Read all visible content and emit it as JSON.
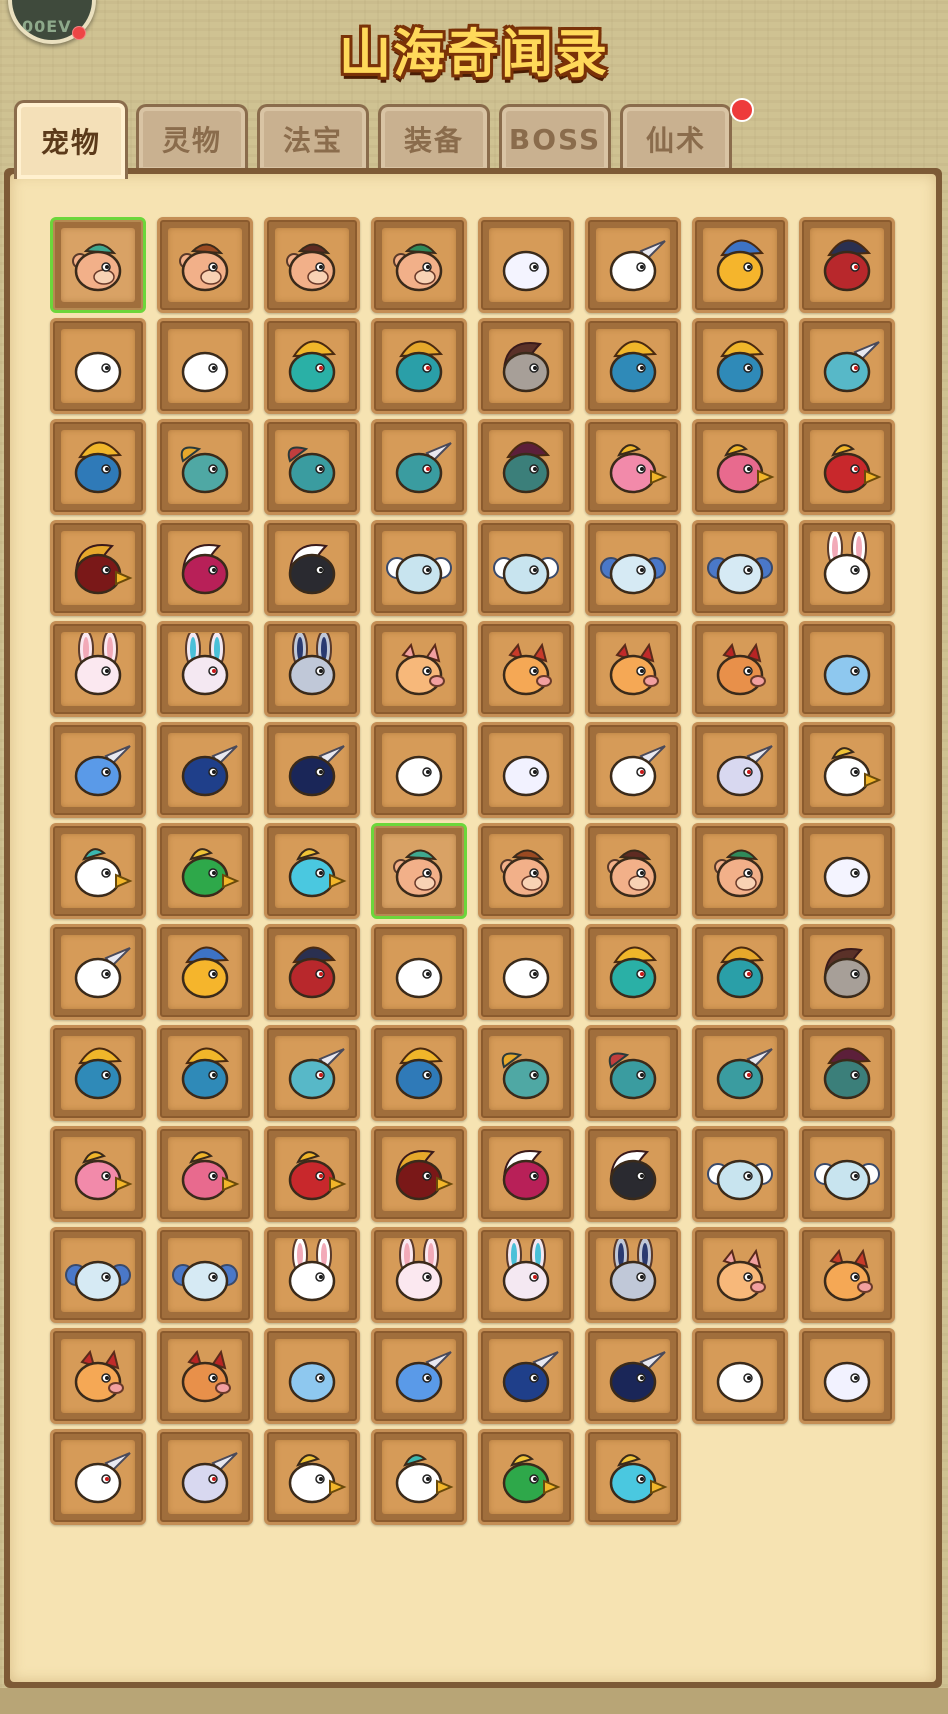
{
  "header": {
    "title": "山海奇闻录",
    "avatar_text": "00EV"
  },
  "tabs": [
    {
      "label": "宠物",
      "active": true
    },
    {
      "label": "灵物",
      "active": false
    },
    {
      "label": "法宝",
      "active": false
    },
    {
      "label": "装备",
      "active": false
    },
    {
      "label": "BOSS",
      "active": false
    },
    {
      "label": "仙术",
      "active": false,
      "badge": true
    }
  ],
  "colors": {
    "selected_border": "#6cd63b",
    "notification_dot": "#ee3b3b",
    "title_fill": "#ffd95a"
  },
  "pets": [
    {
      "icon": "monkey-head-icon",
      "accent": "#f2b089",
      "hair": "#3fa88f",
      "selected": true
    },
    {
      "icon": "monkey-head-icon",
      "accent": "#f2b089",
      "hair": "#9a4a22"
    },
    {
      "icon": "monkey-head-icon",
      "accent": "#f2b089",
      "hair": "#5e2b22"
    },
    {
      "icon": "monkey-head-icon",
      "accent": "#f2b089",
      "hair": "#2f8a5a"
    },
    {
      "icon": "white-beast-head-icon",
      "accent": "#f4f4ff",
      "hair": "#d9dcf0"
    },
    {
      "icon": "unicorn-head-icon",
      "accent": "#ffffff",
      "hair": "#6b66d6"
    },
    {
      "icon": "helmet-head-icon",
      "accent": "#f5b52c",
      "hair": "#3d73c4"
    },
    {
      "icon": "red-helmet-head-icon",
      "accent": "#b8282c",
      "hair": "#2a3050"
    },
    {
      "icon": "white-beast-head-icon",
      "accent": "#ffffff",
      "hair": "#f0c437"
    },
    {
      "icon": "white-beast-head-icon",
      "accent": "#ffffff",
      "hair": "#f0b62a"
    },
    {
      "icon": "armored-beast-head-icon",
      "accent": "#2ab0a6",
      "hair": "#f0b62a"
    },
    {
      "icon": "armored-beast-head-icon",
      "accent": "#2a9fa8",
      "hair": "#e6a82b"
    },
    {
      "icon": "grey-beast-head-icon",
      "accent": "#a79f98",
      "hair": "#5a3128"
    },
    {
      "icon": "helmet-head-icon",
      "accent": "#2f8ab8",
      "hair": "#f0b62a"
    },
    {
      "icon": "helmet-head-icon",
      "accent": "#2f8ab8",
      "hair": "#f0b62a"
    },
    {
      "icon": "horned-helmet-head-icon",
      "accent": "#57b8c8",
      "hair": "#f0b62a"
    },
    {
      "icon": "dragon-head-icon",
      "accent": "#2f7ab8",
      "hair": "#f0b62a"
    },
    {
      "icon": "fish-head-icon",
      "accent": "#4fa8a4",
      "hair": "#e6a82b"
    },
    {
      "icon": "fish-head-icon",
      "accent": "#3a9ca0",
      "hair": "#c13e3e"
    },
    {
      "icon": "horned-fish-head-icon",
      "accent": "#3a9ca0",
      "hair": "#7b2a2a"
    },
    {
      "icon": "dark-dragon-head-icon",
      "accent": "#3b7f7a",
      "hair": "#5c1f3a"
    },
    {
      "icon": "bird-head-icon",
      "accent": "#f28aaa",
      "hair": "#f0b62a"
    },
    {
      "icon": "bird-head-icon",
      "accent": "#e86a8e",
      "hair": "#f0b62a"
    },
    {
      "icon": "red-bird-head-icon",
      "accent": "#c8282c",
      "hair": "#f0b62a"
    },
    {
      "icon": "phoenix-head-icon",
      "accent": "#7a1818",
      "hair": "#e6a82b"
    },
    {
      "icon": "wolf-head-icon",
      "accent": "#b82058",
      "hair": "#ffffff"
    },
    {
      "icon": "dark-wolf-head-icon",
      "accent": "#2a2a30",
      "hair": "#ffffff"
    },
    {
      "icon": "sheep-head-icon",
      "accent": "#c8e4ef",
      "hair": "#ffffff"
    },
    {
      "icon": "sheep-head-icon",
      "accent": "#c8e4ef",
      "hair": "#ffffff"
    },
    {
      "icon": "sheep-head-icon",
      "accent": "#d6eaf4",
      "hair": "#4a78c8"
    },
    {
      "icon": "sheep-head-icon",
      "accent": "#d6eaf4",
      "hair": "#4a78c8"
    },
    {
      "icon": "rabbit-head-icon",
      "accent": "#ffffff",
      "hair": "#f2aab8"
    },
    {
      "icon": "rabbit-head-icon",
      "accent": "#fbe8f0",
      "hair": "#f2aab8"
    },
    {
      "icon": "armored-rabbit-head-icon",
      "accent": "#f4e8f2",
      "hair": "#4ac0d8"
    },
    {
      "icon": "robot-rabbit-head-icon",
      "accent": "#c0c8d8",
      "hair": "#2a3a70"
    },
    {
      "icon": "pig-head-icon",
      "accent": "#f7b87a",
      "hair": "#f0a0a0"
    },
    {
      "icon": "boar-head-icon",
      "accent": "#f5a855",
      "hair": "#c83a2a"
    },
    {
      "icon": "boar-head-icon",
      "accent": "#f5a855",
      "hair": "#c02a2a"
    },
    {
      "icon": "boar-head-icon",
      "accent": "#e8904a",
      "hair": "#b82424"
    },
    {
      "icon": "blue-beast-head-icon",
      "accent": "#8ec8ef",
      "hair": "#5aa0e0"
    },
    {
      "icon": "blue-unicorn-head-icon",
      "accent": "#5a9ae8",
      "hair": "#3a6fd0"
    },
    {
      "icon": "knight-head-icon",
      "accent": "#1f3f8a",
      "hair": "#c8ccd8"
    },
    {
      "icon": "dark-knight-head-icon",
      "accent": "#1a2658",
      "hair": "#c8ccd8"
    },
    {
      "icon": "white-beast-head-icon",
      "accent": "#ffffff",
      "hair": "#c8282c"
    },
    {
      "icon": "white-beast-head-icon",
      "accent": "#f2f2ff",
      "hair": "#c8282c"
    },
    {
      "icon": "horned-beast-head-icon",
      "accent": "#ffffff",
      "hair": "#b81818"
    },
    {
      "icon": "demon-head-icon",
      "accent": "#d8d8f0",
      "hair": "#a81818"
    },
    {
      "icon": "chick-head-icon",
      "accent": "#ffffff",
      "hair": "#f0c437"
    },
    {
      "icon": "eagle-head-icon",
      "accent": "#ffffff",
      "hair": "#3ab8b0"
    },
    {
      "icon": "green-bird-head-icon",
      "accent": "#2ea84a",
      "hair": "#f0c437"
    },
    {
      "icon": "cyan-bird-head-icon",
      "accent": "#4ac8e0",
      "hair": "#f0c437"
    },
    {
      "icon": "monkey-head-icon",
      "accent": "#f2b089",
      "hair": "#3fa88f",
      "selected": true
    },
    {
      "icon": "monkey-head-icon",
      "accent": "#f2b089",
      "hair": "#9a4a22"
    },
    {
      "icon": "monkey-head-icon",
      "accent": "#f2b089",
      "hair": "#5e2b22"
    },
    {
      "icon": "monkey-head-icon",
      "accent": "#f2b089",
      "hair": "#2f8a5a"
    },
    {
      "icon": "white-beast-head-icon",
      "accent": "#f4f4ff",
      "hair": "#d9dcf0"
    },
    {
      "icon": "unicorn-head-icon",
      "accent": "#ffffff",
      "hair": "#6b66d6"
    },
    {
      "icon": "helmet-head-icon",
      "accent": "#f5b52c",
      "hair": "#3d73c4"
    },
    {
      "icon": "red-helmet-head-icon",
      "accent": "#b8282c",
      "hair": "#2a3050"
    },
    {
      "icon": "white-beast-head-icon",
      "accent": "#ffffff",
      "hair": "#f0c437"
    },
    {
      "icon": "white-beast-head-icon",
      "accent": "#ffffff",
      "hair": "#f0b62a"
    },
    {
      "icon": "armored-beast-head-icon",
      "accent": "#2ab0a6",
      "hair": "#f0b62a"
    },
    {
      "icon": "armored-beast-head-icon",
      "accent": "#2a9fa8",
      "hair": "#e6a82b"
    },
    {
      "icon": "grey-beast-head-icon",
      "accent": "#a79f98",
      "hair": "#5a3128"
    },
    {
      "icon": "helmet-head-icon",
      "accent": "#2f8ab8",
      "hair": "#f0b62a"
    },
    {
      "icon": "helmet-head-icon",
      "accent": "#2f8ab8",
      "hair": "#f0b62a"
    },
    {
      "icon": "horned-helmet-head-icon",
      "accent": "#57b8c8",
      "hair": "#f0b62a"
    },
    {
      "icon": "dragon-head-icon",
      "accent": "#2f7ab8",
      "hair": "#f0b62a"
    },
    {
      "icon": "fish-head-icon",
      "accent": "#4fa8a4",
      "hair": "#e6a82b"
    },
    {
      "icon": "fish-head-icon",
      "accent": "#3a9ca0",
      "hair": "#c13e3e"
    },
    {
      "icon": "horned-fish-head-icon",
      "accent": "#3a9ca0",
      "hair": "#7b2a2a"
    },
    {
      "icon": "dark-dragon-head-icon",
      "accent": "#3b7f7a",
      "hair": "#5c1f3a"
    },
    {
      "icon": "bird-head-icon",
      "accent": "#f28aaa",
      "hair": "#f0b62a"
    },
    {
      "icon": "bird-head-icon",
      "accent": "#e86a8e",
      "hair": "#f0b62a"
    },
    {
      "icon": "red-bird-head-icon",
      "accent": "#c8282c",
      "hair": "#f0b62a"
    },
    {
      "icon": "phoenix-head-icon",
      "accent": "#7a1818",
      "hair": "#e6a82b"
    },
    {
      "icon": "wolf-head-icon",
      "accent": "#b82058",
      "hair": "#ffffff"
    },
    {
      "icon": "dark-wolf-head-icon",
      "accent": "#2a2a30",
      "hair": "#ffffff"
    },
    {
      "icon": "sheep-head-icon",
      "accent": "#c8e4ef",
      "hair": "#ffffff"
    },
    {
      "icon": "sheep-head-icon",
      "accent": "#c8e4ef",
      "hair": "#ffffff"
    },
    {
      "icon": "sheep-head-icon",
      "accent": "#d6eaf4",
      "hair": "#4a78c8"
    },
    {
      "icon": "sheep-head-icon",
      "accent": "#d6eaf4",
      "hair": "#4a78c8"
    },
    {
      "icon": "rabbit-head-icon",
      "accent": "#ffffff",
      "hair": "#f2aab8"
    },
    {
      "icon": "rabbit-head-icon",
      "accent": "#fbe8f0",
      "hair": "#f2aab8"
    },
    {
      "icon": "armored-rabbit-head-icon",
      "accent": "#f4e8f2",
      "hair": "#4ac0d8"
    },
    {
      "icon": "robot-rabbit-head-icon",
      "accent": "#c0c8d8",
      "hair": "#2a3a70"
    },
    {
      "icon": "pig-head-icon",
      "accent": "#f7b87a",
      "hair": "#f0a0a0"
    },
    {
      "icon": "boar-head-icon",
      "accent": "#f5a855",
      "hair": "#c83a2a"
    },
    {
      "icon": "boar-head-icon",
      "accent": "#f5a855",
      "hair": "#c02a2a"
    },
    {
      "icon": "boar-head-icon",
      "accent": "#e8904a",
      "hair": "#b82424"
    },
    {
      "icon": "blue-beast-head-icon",
      "accent": "#8ec8ef",
      "hair": "#5aa0e0"
    },
    {
      "icon": "blue-unicorn-head-icon",
      "accent": "#5a9ae8",
      "hair": "#3a6fd0"
    },
    {
      "icon": "knight-head-icon",
      "accent": "#1f3f8a",
      "hair": "#c8ccd8"
    },
    {
      "icon": "dark-knight-head-icon",
      "accent": "#1a2658",
      "hair": "#c8ccd8"
    },
    {
      "icon": "white-beast-head-icon",
      "accent": "#ffffff",
      "hair": "#c8282c"
    },
    {
      "icon": "white-beast-head-icon",
      "accent": "#f2f2ff",
      "hair": "#c8282c"
    },
    {
      "icon": "horned-beast-head-icon",
      "accent": "#ffffff",
      "hair": "#b81818"
    },
    {
      "icon": "demon-head-icon",
      "accent": "#d8d8f0",
      "hair": "#a81818"
    },
    {
      "icon": "chick-head-icon",
      "accent": "#ffffff",
      "hair": "#f0c437"
    },
    {
      "icon": "eagle-head-icon",
      "accent": "#ffffff",
      "hair": "#3ab8b0"
    },
    {
      "icon": "green-bird-head-icon",
      "accent": "#2ea84a",
      "hair": "#f0c437"
    },
    {
      "icon": "cyan-bird-head-icon",
      "accent": "#4ac8e0",
      "hair": "#f0c437"
    }
  ]
}
